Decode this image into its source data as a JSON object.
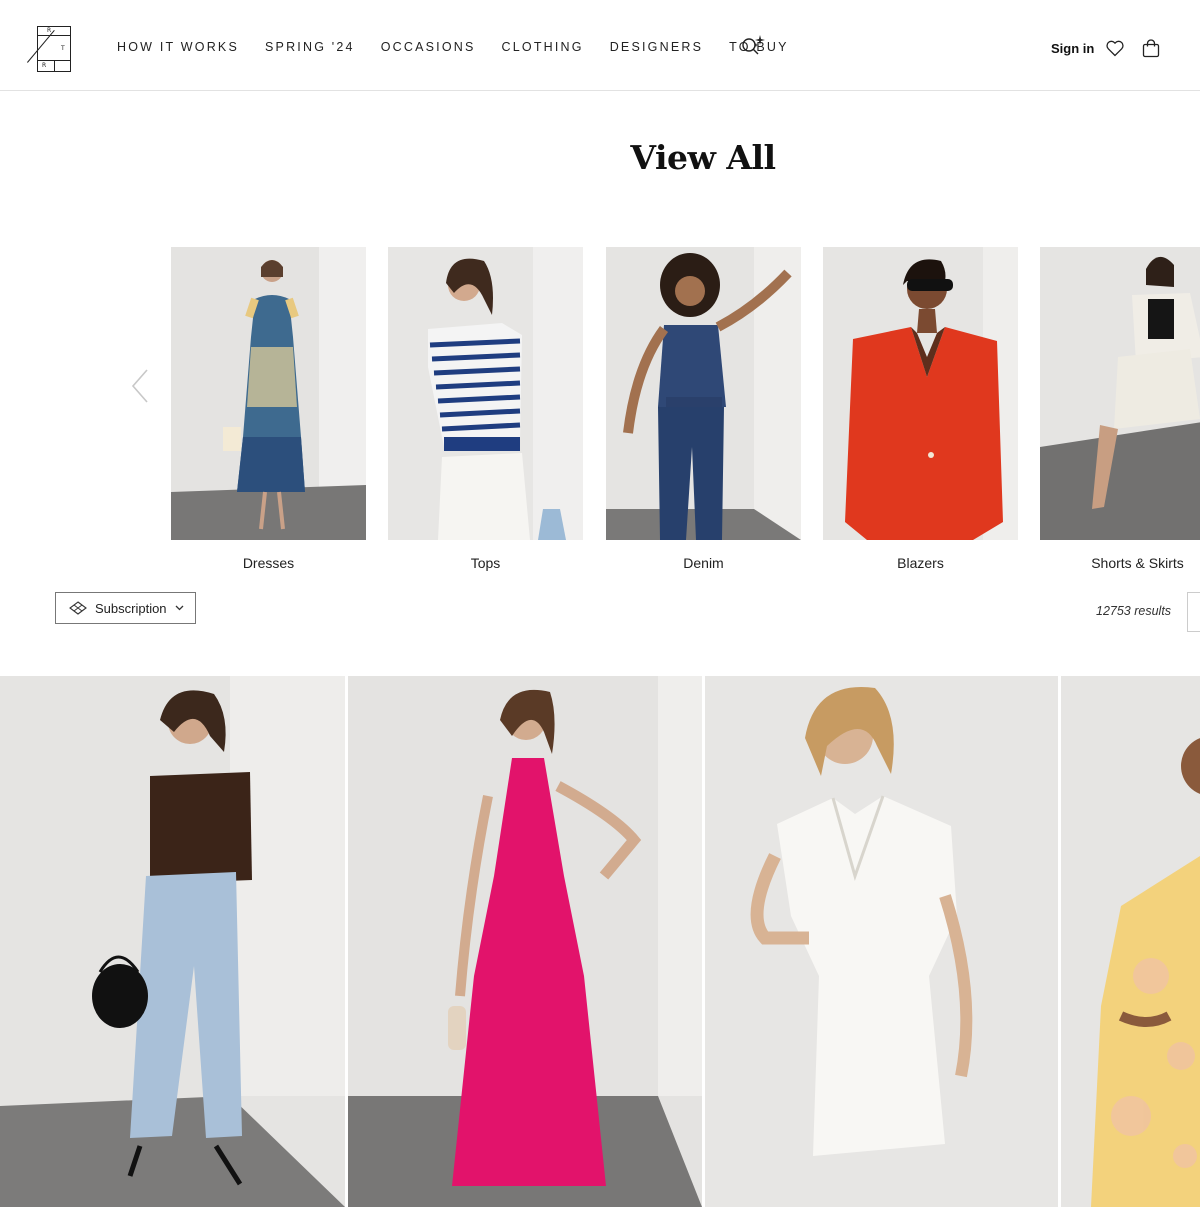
{
  "logo": {
    "letters": [
      "R",
      "T",
      "R"
    ]
  },
  "nav": {
    "items": [
      "HOW IT WORKS",
      "SPRING '24",
      "OCCASIONS",
      "CLOTHING",
      "DESIGNERS",
      "TO BUY"
    ]
  },
  "header_actions": {
    "signin_label": "Sign in"
  },
  "page": {
    "title": "View All"
  },
  "categories": [
    {
      "label": "Dresses"
    },
    {
      "label": "Tops"
    },
    {
      "label": "Denim"
    },
    {
      "label": "Blazers"
    },
    {
      "label": "Shorts & Skirts"
    }
  ],
  "filters": {
    "subscription_label": "Subscription",
    "results_text": "12753 results"
  },
  "colors": {
    "text": "#222222",
    "border": "#e2e2e2",
    "background": "#ffffff",
    "studio_wall": "#e6e5e3",
    "studio_floor": "#757473"
  },
  "icons": [
    "ai-search-icon",
    "heart-icon",
    "shopping-bag-icon",
    "chevron-left-icon",
    "subscription-icon",
    "chevron-down-icon"
  ]
}
